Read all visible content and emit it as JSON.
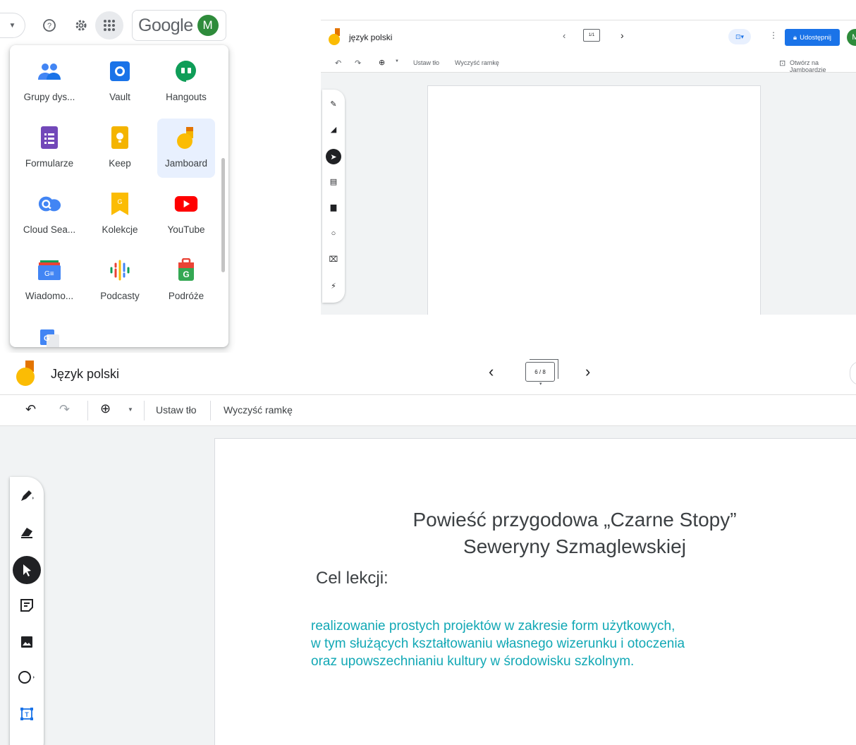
{
  "launcher": {
    "google_label": "Google",
    "avatar_letter": "M",
    "apps": [
      {
        "label": "Grupy dys...",
        "icon": "groups-icon"
      },
      {
        "label": "Vault",
        "icon": "vault-icon"
      },
      {
        "label": "Hangouts",
        "icon": "hangouts-icon"
      },
      {
        "label": "Formularze",
        "icon": "forms-icon"
      },
      {
        "label": "Keep",
        "icon": "keep-icon"
      },
      {
        "label": "Jamboard",
        "icon": "jamboard-icon"
      },
      {
        "label": "Cloud Sea...",
        "icon": "cloud-search-icon"
      },
      {
        "label": "Kolekcje",
        "icon": "collections-icon"
      },
      {
        "label": "YouTube",
        "icon": "youtube-icon"
      },
      {
        "label": "Wiadomo...",
        "icon": "news-icon"
      },
      {
        "label": "Podcasty",
        "icon": "podcasts-icon"
      },
      {
        "label": "Podróże",
        "icon": "travel-icon"
      }
    ]
  },
  "small_jam": {
    "title": "język polski",
    "frame_counter": "1/1",
    "share_label": "Udostępnij",
    "avatar_letter": "M",
    "set_background": "Ustaw tło",
    "clear_frame": "Wyczyść ramkę",
    "open_on_jamboard": "Otwórz na Jamboardzie"
  },
  "big_jam": {
    "title": "Język polski",
    "frame_counter": "6 / 8",
    "set_background": "Ustaw tło",
    "clear_frame": "Wyczyść ramkę",
    "slide": {
      "title_line1": "Powieść przygodowa „Czarne Stopy”",
      "title_line2": "Seweryny Szmaglewskiej",
      "goal_label": "Cel lekcji:",
      "body_line1": "realizowanie prostych projektów w zakresie form użytkowych,",
      "body_line2": "w tym służących kształtowaniu własnego wizerunku i otoczenia",
      "body_line3": "oraz upowszechnianiu kultury w środowisku szkolnym."
    }
  },
  "colors": {
    "accent_blue": "#1a73e8",
    "slide_body_teal": "#12a8b5",
    "avatar_green": "#2e8b3b",
    "jamboard_yellow": "#f4b400"
  }
}
